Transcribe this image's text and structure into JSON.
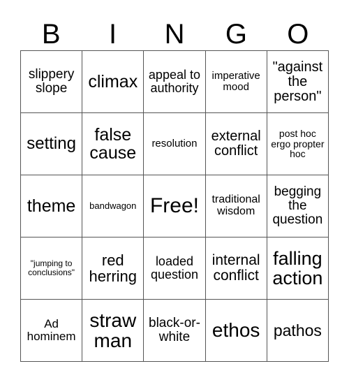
{
  "header": [
    "B",
    "I",
    "N",
    "G",
    "O"
  ],
  "rows": [
    [
      {
        "t": "slippery slope",
        "s": 19
      },
      {
        "t": "climax",
        "s": 25
      },
      {
        "t": "appeal to authority",
        "s": 18
      },
      {
        "t": "imperative mood",
        "s": 15
      },
      {
        "t": "\"against the person\"",
        "s": 20
      }
    ],
    [
      {
        "t": "setting",
        "s": 24
      },
      {
        "t": "false cause",
        "s": 25
      },
      {
        "t": "resolution",
        "s": 15
      },
      {
        "t": "external conflict",
        "s": 20
      },
      {
        "t": "post hoc ergo propter hoc",
        "s": 14
      }
    ],
    [
      {
        "t": "theme",
        "s": 25
      },
      {
        "t": "bandwagon",
        "s": 13
      },
      {
        "t": "Free!",
        "s": 30
      },
      {
        "t": "traditional wisdom",
        "s": 16
      },
      {
        "t": "begging the question",
        "s": 19
      }
    ],
    [
      {
        "t": "\"jumping to conclusions\"",
        "s": 12
      },
      {
        "t": "red herring",
        "s": 22
      },
      {
        "t": "loaded question",
        "s": 18
      },
      {
        "t": "internal conflict",
        "s": 21
      },
      {
        "t": "falling action",
        "s": 27
      }
    ],
    [
      {
        "t": "Ad hominem",
        "s": 17
      },
      {
        "t": "straw man",
        "s": 28
      },
      {
        "t": "black-or-white",
        "s": 19
      },
      {
        "t": "ethos",
        "s": 28
      },
      {
        "t": "pathos",
        "s": 23
      }
    ]
  ]
}
